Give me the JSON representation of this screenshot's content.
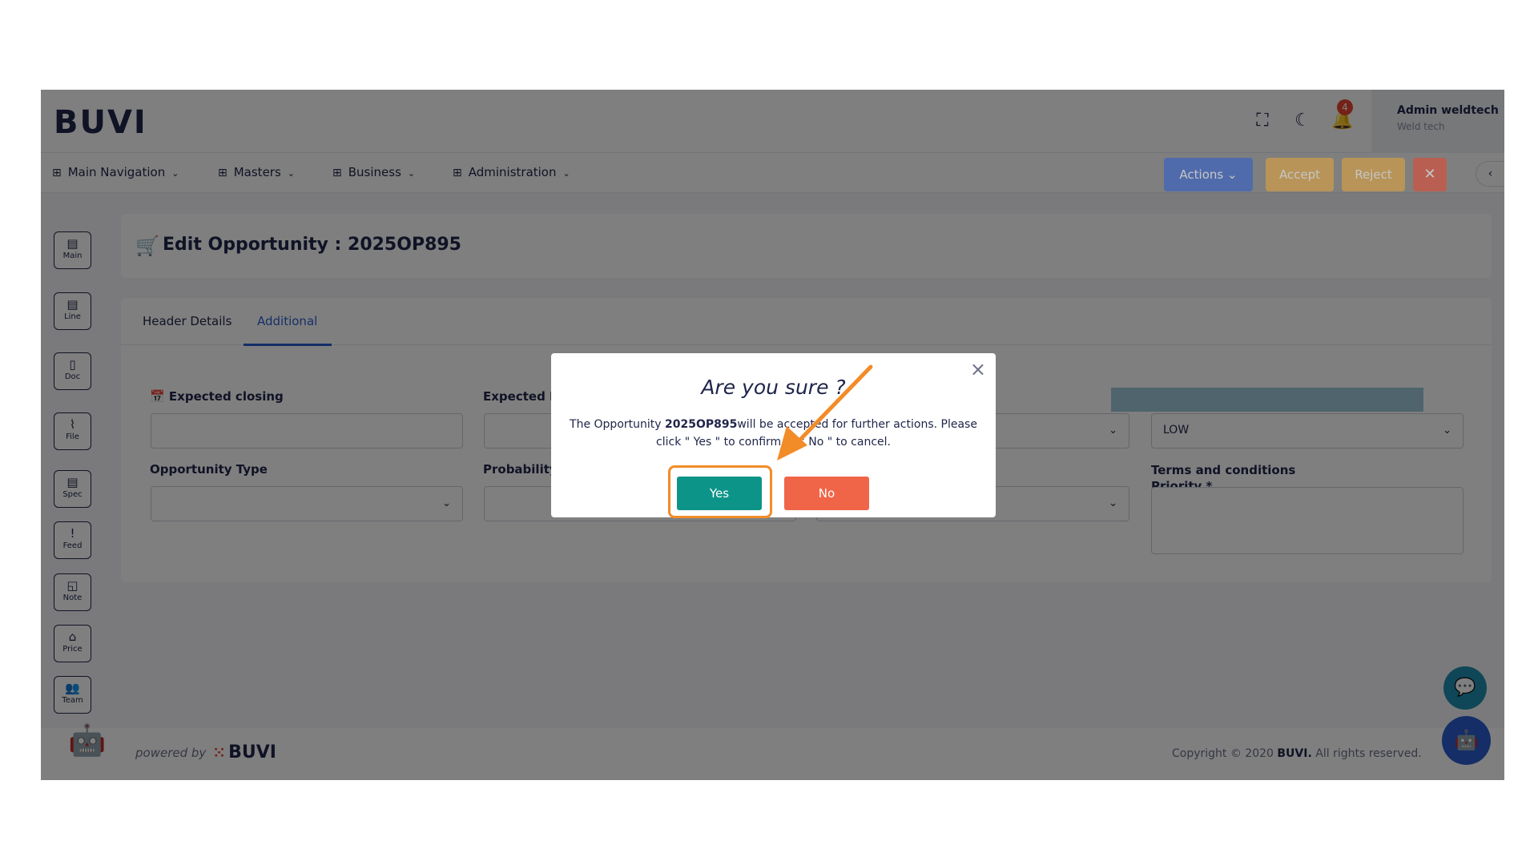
{
  "app": {
    "logo": "BUVI"
  },
  "header": {
    "notification_count": "4",
    "user_name": "Admin weldtech",
    "user_org": "Weld tech"
  },
  "nav": {
    "items": [
      {
        "label": "Main Navigation"
      },
      {
        "label": "Masters"
      },
      {
        "label": "Business"
      },
      {
        "label": "Administration"
      }
    ]
  },
  "rail": {
    "items": [
      {
        "label": "Main",
        "icon": "document-icon"
      },
      {
        "label": "Line",
        "icon": "document-icon"
      },
      {
        "label": "Doc",
        "icon": "file-icon"
      },
      {
        "label": "File",
        "icon": "paperclip-icon"
      },
      {
        "label": "Spec",
        "icon": "document-icon"
      },
      {
        "label": "Feed",
        "icon": "feedback-icon"
      },
      {
        "label": "Note",
        "icon": "note-icon"
      },
      {
        "label": "Price",
        "icon": "tag-icon"
      },
      {
        "label": "Team",
        "icon": "team-icon"
      }
    ]
  },
  "page": {
    "title": "Edit Opportunity : 2025OP895",
    "actions_label": "Actions",
    "accept_label": "Accept",
    "reject_label": "Reject",
    "close_label": "✕"
  },
  "tabs": [
    {
      "label": "Header Details"
    },
    {
      "label": "Additional"
    }
  ],
  "form": {
    "expected_closing_label": "Expected closing",
    "expected_revenue_label": "Expected Re",
    "opportunity_type_label": "Opportunity Type",
    "probability_label": "Probability",
    "priority_label": "Priority *",
    "priority_value": "LOW",
    "terms_label": "Terms and conditions"
  },
  "footer": {
    "powered_by": "powered by",
    "brand": "BUVI",
    "copyright_prefix": "Copyright © 2020",
    "copyright_brand": "BUVI.",
    "copyright_suffix": "All rights reserved."
  },
  "modal": {
    "title": "Are you sure ?",
    "msg_prefix": "The Opportunity",
    "msg_id": "2025OP895",
    "msg_line1_rest": "will be accepted for further actions. Please",
    "msg_line2": "click \" Yes \" to confirm or \" No \" to cancel.",
    "yes_label": "Yes",
    "no_label": "No"
  },
  "colors": {
    "primary": "#2b5ccf",
    "warning": "#e8a63a",
    "danger": "#e8452f",
    "success": "#0d9488",
    "no_button": "#f06548",
    "highlight": "#f28c28"
  }
}
